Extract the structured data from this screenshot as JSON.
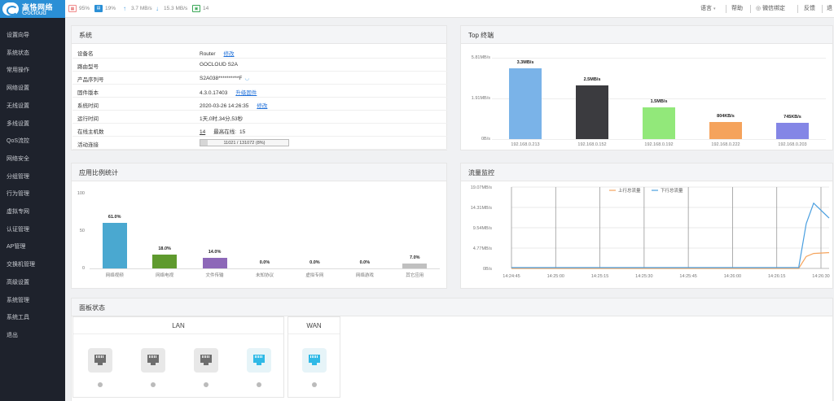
{
  "brand": {
    "name_cn": "高恪网络",
    "name_en": "Gocloud"
  },
  "status": {
    "cpu_icon": "cpu-icon",
    "cpu": "95%",
    "mem_icon": "memory-icon",
    "mem": "19%",
    "up_icon": "upload-arrow-icon",
    "up": "3.7 MB/s",
    "down_icon": "download-arrow-icon",
    "down": "15.3 MB/s",
    "conn_icon": "connection-icon",
    "conn": "14"
  },
  "topnav": {
    "language": "语言",
    "help": "帮助",
    "wechat": "微信绑定",
    "feedback": "反馈",
    "more": "退"
  },
  "sidebar": {
    "items": [
      "设置向导",
      "系统状态",
      "常用操作",
      "网络设置",
      "无线设置",
      "多线设置",
      "QoS流控",
      "网络安全",
      "分组管理",
      "行为管理",
      "虚拟专网",
      "认证管理",
      "AP管理",
      "交换机管理",
      "高级设置",
      "系统管理",
      "系统工具",
      "退出"
    ]
  },
  "system_panel": {
    "title": "系统",
    "rows": [
      {
        "key": "设备名",
        "value": "Router",
        "link": "修改"
      },
      {
        "key": "路由型号",
        "value": "GOCLOUD S2A",
        "link": ""
      },
      {
        "key": "产品序列号",
        "value": "S2A038**********F",
        "link": ""
      },
      {
        "key": "固件版本",
        "value": "4.3.0.17403",
        "link": "升级固件"
      },
      {
        "key": "系统时间",
        "value": "2020-03-26 14:26:35",
        "link": "修改"
      },
      {
        "key": "运行时间",
        "value": "1天,0时,34分,53秒",
        "link": ""
      },
      {
        "key": "在线主机数",
        "value": "14",
        "link": "",
        "extra_label": "最高在线:",
        "extra_value": "15"
      },
      {
        "key": "活动连接",
        "value": "",
        "link": ""
      }
    ],
    "active_conn": {
      "text": "11021 / 131072 (8%)",
      "fraction": 0.08
    }
  },
  "top_panel": {
    "title": "Top 终端"
  },
  "app_panel": {
    "title": "应用比例统计"
  },
  "traffic_panel": {
    "title": "流量监控"
  },
  "board_panel": {
    "title": "面板状态",
    "lan_label": "LAN",
    "wan_label": "WAN"
  },
  "chart_data": [
    {
      "type": "bar",
      "title": "Top 终端",
      "categories": [
        "192.168.0.213",
        "192.168.0.152",
        "192.168.0.192",
        "192.168.0.222",
        "192.168.0.203"
      ],
      "values": [
        3.3,
        2.5,
        1.5,
        0.804,
        0.745
      ],
      "value_labels": [
        "3.3MB/s",
        "2.5MB/s",
        "1.5MB/s",
        "804KB/s",
        "745KB/s"
      ],
      "colors": [
        "#7ab3e8",
        "#3b3b3f",
        "#92e87a",
        "#f5a35c",
        "#8486e6"
      ],
      "yticks": [
        "5.81MB/s",
        "1.91MB/s",
        "0B/s"
      ],
      "ylim": [
        0,
        3.81
      ]
    },
    {
      "type": "bar",
      "title": "应用比例统计",
      "categories": [
        "网络视频",
        "网络电视",
        "文件传输",
        "未知协议",
        "虚拟专网",
        "网络游戏",
        "其它应用"
      ],
      "values": [
        61.0,
        18.0,
        14.0,
        0.0,
        0.0,
        0.0,
        7.0
      ],
      "value_labels": [
        "61.0%",
        "18.0%",
        "14.0%",
        "0.0%",
        "0.0%",
        "0.0%",
        "7.0%"
      ],
      "colors": [
        "#4aa8d0",
        "#5f9a2e",
        "#8d68b8",
        "#cccccc",
        "#cccccc",
        "#cccccc",
        "#c0c0c0"
      ],
      "yticks": [
        "100",
        "50",
        "0"
      ],
      "ylim": [
        0,
        100
      ]
    },
    {
      "type": "line",
      "title": "流量监控",
      "x": [
        "14:24:45",
        "14:25:00",
        "14:25:15",
        "14:25:30",
        "14:25:45",
        "14:26:00",
        "14:26:15",
        "14:26:30"
      ],
      "yticks": [
        "19.07MB/s",
        "14.31MB/s",
        "9.54MB/s",
        "4.77MB/s",
        "0B/s"
      ],
      "ylim": [
        0,
        19.07
      ],
      "series": [
        {
          "name": "上行总流量",
          "color": "#f5a35c",
          "values": [
            0,
            0,
            0,
            0,
            0,
            0,
            0,
            0.1,
            2.8,
            3.5,
            3.7
          ]
        },
        {
          "name": "下行总流量",
          "color": "#4a9fe0",
          "values": [
            0.2,
            0.2,
            0.2,
            0.2,
            0.2,
            0.2,
            0.2,
            0.5,
            10.5,
            15.3,
            11.8
          ]
        }
      ]
    }
  ]
}
